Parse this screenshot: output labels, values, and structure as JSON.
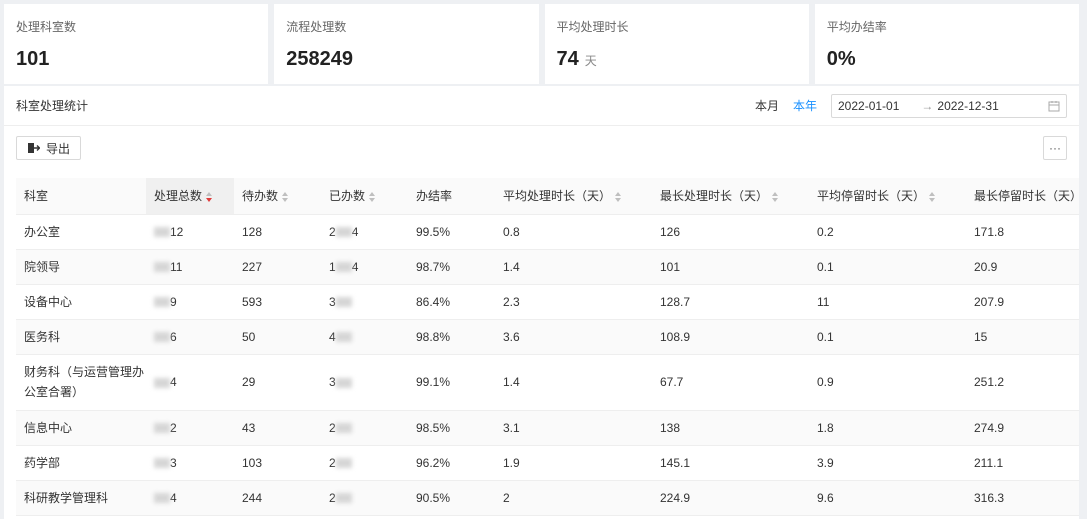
{
  "stats": [
    {
      "label": "处理科室数",
      "value": "101",
      "unit": ""
    },
    {
      "label": "流程处理数",
      "value": "258249",
      "unit": ""
    },
    {
      "label": "平均处理时长",
      "value": "74",
      "unit": "天"
    },
    {
      "label": "平均办结率",
      "value": "0%",
      "unit": ""
    }
  ],
  "panel": {
    "title": "科室处理统计",
    "range_month": "本月",
    "range_year": "本年",
    "date_start": "2022-01-01",
    "date_arrow": "→",
    "date_end": "2022-12-31",
    "export_label": "导出",
    "more_label": "···"
  },
  "table": {
    "columns": [
      "科室",
      "处理总数",
      "待办数",
      "已办数",
      "办结率",
      "平均处理时长（天）",
      "最长处理时长（天）",
      "平均停留时长（天）",
      "最长停留时长（天）"
    ],
    "rows": [
      {
        "dept": "办公室",
        "total": "12",
        "pending": "128",
        "done_pre": "2",
        "done_suf": "4",
        "rate": "99.5%",
        "avg_proc": "0.8",
        "max_proc": "126",
        "avg_stay": "0.2",
        "max_stay": "171.8"
      },
      {
        "dept": "院领导",
        "total": "11",
        "pending": "227",
        "done_pre": "1",
        "done_suf": "4",
        "rate": "98.7%",
        "avg_proc": "1.4",
        "max_proc": "101",
        "avg_stay": "0.1",
        "max_stay": "20.9"
      },
      {
        "dept": "设备中心",
        "total": "9",
        "pending": "593",
        "done_pre": "3",
        "done_suf": "",
        "rate": "86.4%",
        "avg_proc": "2.3",
        "max_proc": "128.7",
        "avg_stay": "11",
        "max_stay": "207.9"
      },
      {
        "dept": "医务科",
        "total": "6",
        "pending": "50",
        "done_pre": "4",
        "done_suf": "",
        "rate": "98.8%",
        "avg_proc": "3.6",
        "max_proc": "108.9",
        "avg_stay": "0.1",
        "max_stay": "15"
      },
      {
        "dept": "财务科（与运营管理办公室合署）",
        "total": "4",
        "pending": "29",
        "done_pre": "3",
        "done_suf": "",
        "rate": "99.1%",
        "avg_proc": "1.4",
        "max_proc": "67.7",
        "avg_stay": "0.9",
        "max_stay": "251.2"
      },
      {
        "dept": "信息中心",
        "total": "2",
        "pending": "43",
        "done_pre": "2",
        "done_suf": "",
        "rate": "98.5%",
        "avg_proc": "3.1",
        "max_proc": "138",
        "avg_stay": "1.8",
        "max_stay": "274.9"
      },
      {
        "dept": "药学部",
        "total": "3",
        "pending": "103",
        "done_pre": "2",
        "done_suf": "",
        "rate": "96.2%",
        "avg_proc": "1.9",
        "max_proc": "145.1",
        "avg_stay": "3.9",
        "max_stay": "211.1"
      },
      {
        "dept": "科研教学管理科",
        "total": "4",
        "pending": "244",
        "done_pre": "2",
        "done_suf": "",
        "rate": "90.5%",
        "avg_proc": "2",
        "max_proc": "224.9",
        "avg_stay": "9.6",
        "max_stay": "316.3"
      }
    ]
  }
}
